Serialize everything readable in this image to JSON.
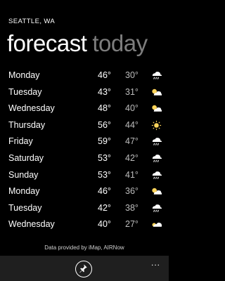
{
  "header": {
    "location": "SEATTLE, WA",
    "tab_active": "forecast",
    "tab_inactive": "today"
  },
  "forecast": [
    {
      "day": "Monday",
      "high": "46°",
      "low": "30°",
      "icon": "rain-icon"
    },
    {
      "day": "Tuesday",
      "high": "43°",
      "low": "31°",
      "icon": "partly-sunny-icon"
    },
    {
      "day": "Wednesday",
      "high": "48°",
      "low": "40°",
      "icon": "partly-sunny-icon"
    },
    {
      "day": "Thursday",
      "high": "56°",
      "low": "44°",
      "icon": "sunny-icon"
    },
    {
      "day": "Friday",
      "high": "59°",
      "low": "47°",
      "icon": "rain-icon"
    },
    {
      "day": "Saturday",
      "high": "53°",
      "low": "42°",
      "icon": "rain-icon"
    },
    {
      "day": "Sunday",
      "high": "53°",
      "low": "41°",
      "icon": "rain-icon"
    },
    {
      "day": "Monday",
      "high": "46°",
      "low": "36°",
      "icon": "partly-sunny-icon"
    },
    {
      "day": "Tuesday",
      "high": "42°",
      "low": "38°",
      "icon": "rain-icon"
    },
    {
      "day": "Wednesday",
      "high": "40°",
      "low": "27°",
      "icon": "partly-cloudy-icon"
    }
  ],
  "footer": {
    "data_source": "Data provided by iMap, AIRNow"
  },
  "app_bar": {
    "pin_icon": "pin-icon",
    "more_label": "..."
  }
}
